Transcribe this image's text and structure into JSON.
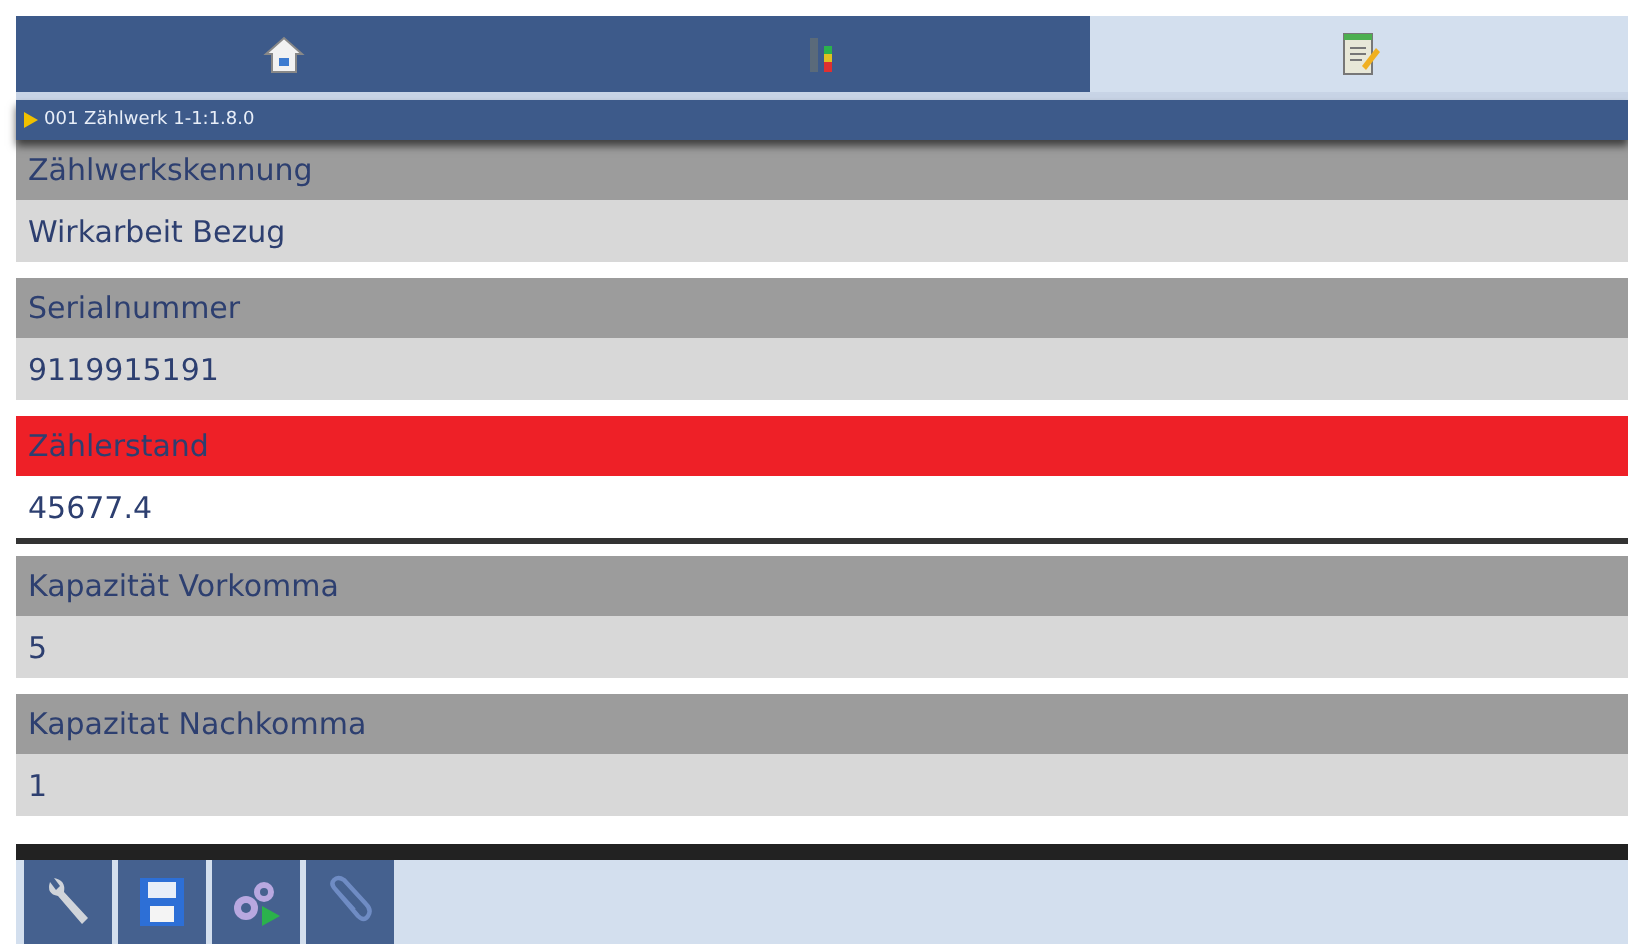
{
  "tabs": [
    {
      "kind": "home",
      "selected": false
    },
    {
      "kind": "meter",
      "selected": false
    },
    {
      "kind": "edit",
      "selected": true
    }
  ],
  "breadcrumb": "001 Zählwerk 1-1:1.8.0",
  "fields": [
    {
      "label": "Zählwerkskennung",
      "value": "Wirkarbeit Bezug",
      "selected": false
    },
    {
      "label": "Serialnummer",
      "value": "9119915191",
      "selected": false
    },
    {
      "label": "Zählerstand",
      "value": "45677.4",
      "selected": true
    },
    {
      "label": "Kapazität Vorkomma",
      "value": "5",
      "selected": false
    },
    {
      "label": "Kapazitat Nachkomma",
      "value": "1",
      "selected": false
    }
  ],
  "toolbar": [
    {
      "kind": "wrench"
    },
    {
      "kind": "save"
    },
    {
      "kind": "run"
    },
    {
      "kind": "attach"
    }
  ]
}
